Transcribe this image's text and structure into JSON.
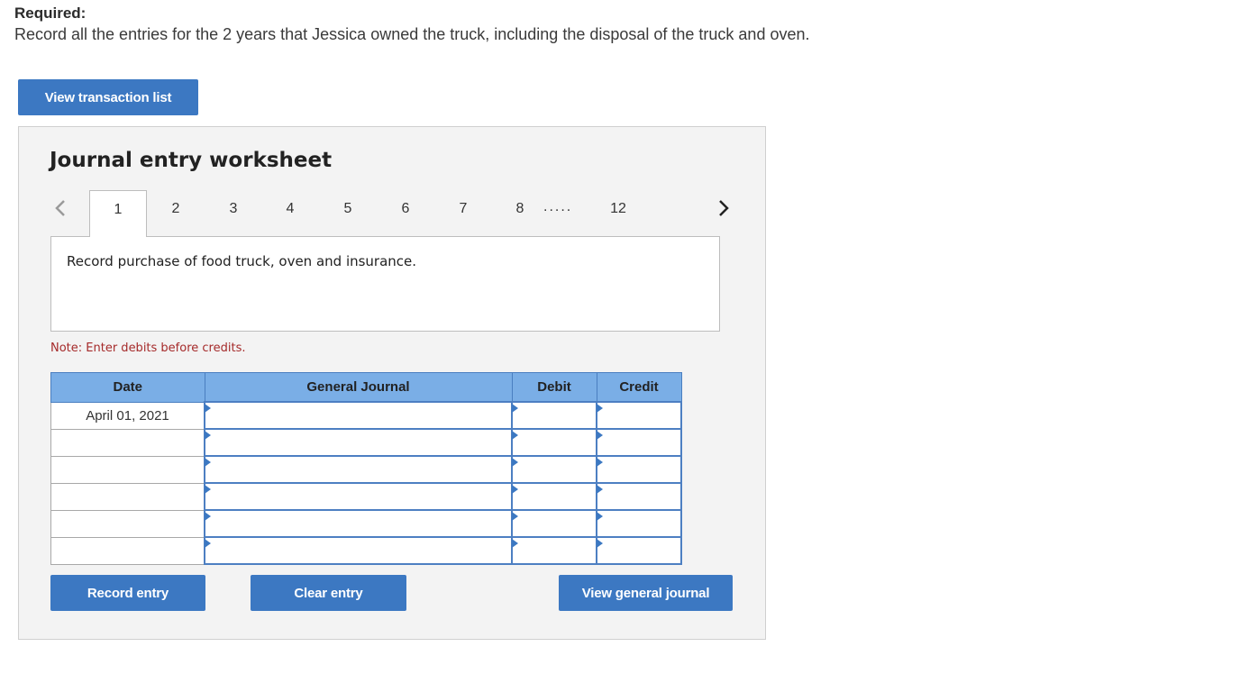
{
  "required": {
    "label": "Required:",
    "text": "Record all the entries for the 2 years that Jessica owned the truck, including the disposal of the truck and oven."
  },
  "view_transaction_list_label": "View transaction list",
  "worksheet": {
    "title": "Journal entry worksheet",
    "tabs": [
      "1",
      "2",
      "3",
      "4",
      "5",
      "6",
      "7",
      "8",
      "12"
    ],
    "active_tab": "1",
    "ellipsis": ".....",
    "description": "Record purchase of food truck, oven and insurance.",
    "note": "Note: Enter debits before credits.",
    "table": {
      "headers": {
        "date": "Date",
        "general_journal": "General Journal",
        "debit": "Debit",
        "credit": "Credit"
      },
      "rows": [
        {
          "date": "April 01, 2021",
          "account": "",
          "debit": "",
          "credit": ""
        },
        {
          "date": "",
          "account": "",
          "debit": "",
          "credit": ""
        },
        {
          "date": "",
          "account": "",
          "debit": "",
          "credit": ""
        },
        {
          "date": "",
          "account": "",
          "debit": "",
          "credit": ""
        },
        {
          "date": "",
          "account": "",
          "debit": "",
          "credit": ""
        },
        {
          "date": "",
          "account": "",
          "debit": "",
          "credit": ""
        }
      ]
    },
    "buttons": {
      "record": "Record entry",
      "clear": "Clear entry",
      "view_general_journal": "View general journal"
    }
  },
  "colors": {
    "button": "#3c78c2",
    "table_header": "#7aaee6",
    "note": "#a52a2a",
    "panel": "#f3f3f3"
  },
  "icons": {
    "prev": "chevron-left-icon",
    "next": "chevron-right-icon"
  }
}
